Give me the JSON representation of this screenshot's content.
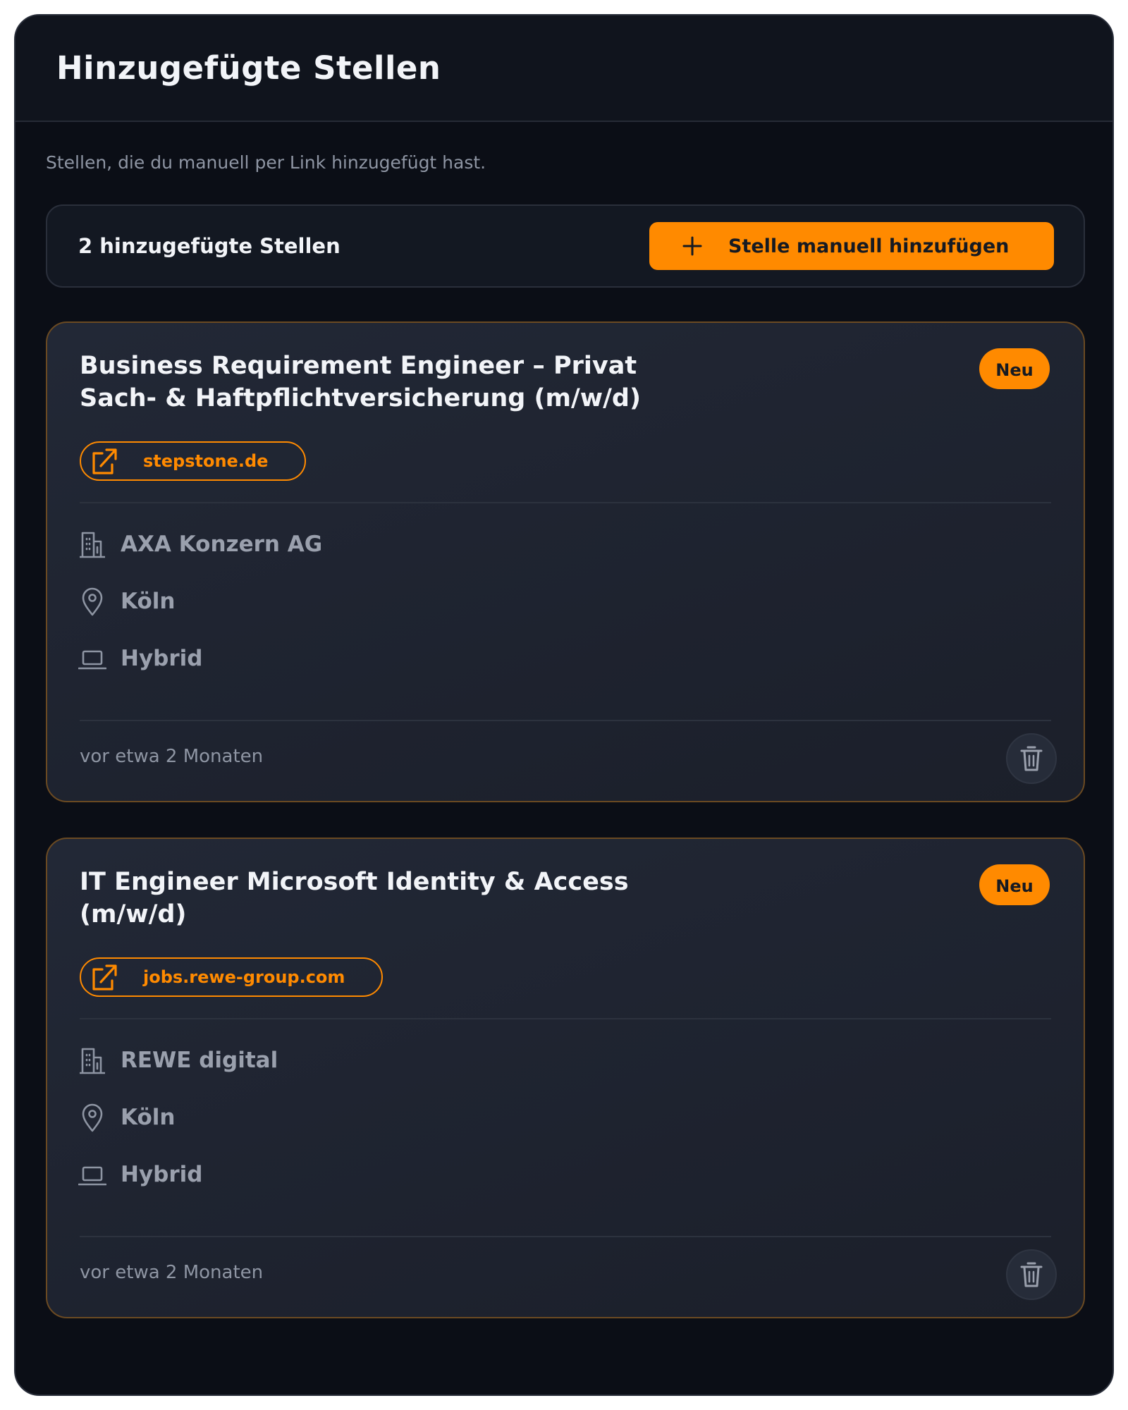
{
  "header": {
    "title": "Hinzugefügte Stellen"
  },
  "subtitle": "Stellen, die du manuell per Link hinzugefügt hast.",
  "summary": {
    "count_label": "2 hinzugefügte Stellen",
    "add_button_label": "Stelle manuell hinzufügen"
  },
  "jobs": [
    {
      "title": "Business Requirement Engineer – Privat Sach- & Haftpflichtversicherung (m/w/d)",
      "badge": "Neu",
      "source": "stepstone.de",
      "company": "AXA Konzern AG",
      "location": "Köln",
      "work_mode": "Hybrid",
      "posted": "vor etwa 2 Monaten"
    },
    {
      "title": "IT Engineer Microsoft Identity & Access (m/w/d)",
      "badge": "Neu",
      "source": "jobs.rewe-group.com",
      "company": "REWE digital",
      "location": "Köln",
      "work_mode": "Hybrid",
      "posted": "vor etwa 2 Monaten"
    }
  ],
  "colors": {
    "accent": "#ff8a00",
    "background": "#0b0e16",
    "card": "#1f2430",
    "text_primary": "#f2f4f8",
    "text_muted": "#9aa0ad"
  },
  "icons": {
    "add": "plus-icon",
    "source": "external-link-icon",
    "company": "building-icon",
    "location": "map-pin-icon",
    "work_mode": "laptop-icon",
    "delete": "trash-icon"
  }
}
